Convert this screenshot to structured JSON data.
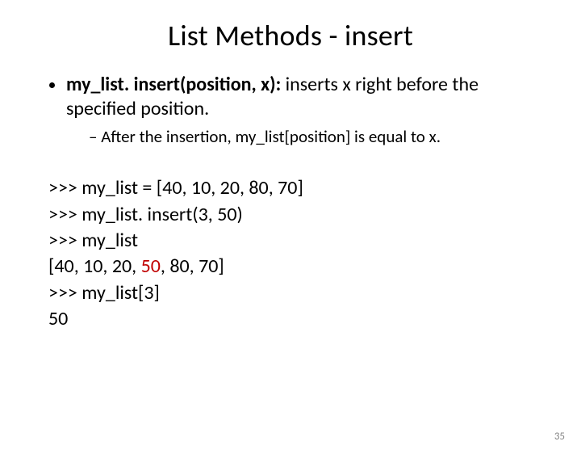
{
  "title": "List Methods - insert",
  "bullet1_strong": "my_list. insert(position, x):",
  "bullet1_rest": " inserts x right before the specified position.",
  "sub1": "After the insertion, my_list[position] is equal to x.",
  "code": {
    "l1": ">>> my_list = [40, 10, 20, 80, 70]",
    "l2": ">>> my_list. insert(3, 50)",
    "l3": ">>> my_list",
    "l4a": "[40, 10, 20, ",
    "l4b": "50",
    "l4c": ", 80, 70]",
    "l5": ">>> my_list[3]",
    "l6": "50"
  },
  "page": "35"
}
